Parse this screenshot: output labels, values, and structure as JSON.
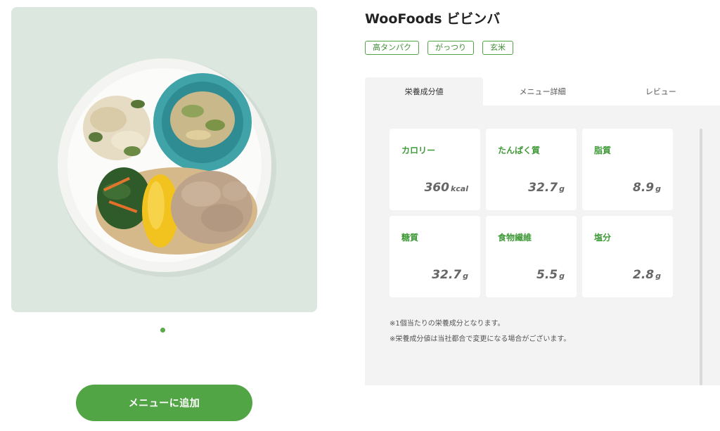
{
  "product": {
    "title": "WooFoods ビビンバ",
    "tags": [
      "高タンパク",
      "がっつり",
      "玄米"
    ]
  },
  "carousel": {
    "page_count": 1,
    "active_index": 0
  },
  "add_button_label": "メニューに追加",
  "tabs": [
    {
      "label": "栄養成分値",
      "active": true
    },
    {
      "label": "メニュー詳細",
      "active": false
    },
    {
      "label": "レビュー",
      "active": false
    }
  ],
  "nutrition": [
    {
      "label": "カロリー",
      "value": "360",
      "unit": "kcal"
    },
    {
      "label": "たんぱく質",
      "value": "32.7",
      "unit": "g"
    },
    {
      "label": "脂質",
      "value": "8.9",
      "unit": "g"
    },
    {
      "label": "糖質",
      "value": "32.7",
      "unit": "g"
    },
    {
      "label": "食物繊維",
      "value": "5.5",
      "unit": "g"
    },
    {
      "label": "塩分",
      "value": "2.8",
      "unit": "g"
    }
  ],
  "notes": [
    "※1個当たりの栄養成分となります。",
    "※栄養成分値は当社都合で変更になる場合がございます。"
  ],
  "colors": {
    "accent": "#52a545",
    "label_green": "#3f9a38",
    "image_bg": "#dbe7df",
    "panel_bg": "#f3f3f3"
  }
}
